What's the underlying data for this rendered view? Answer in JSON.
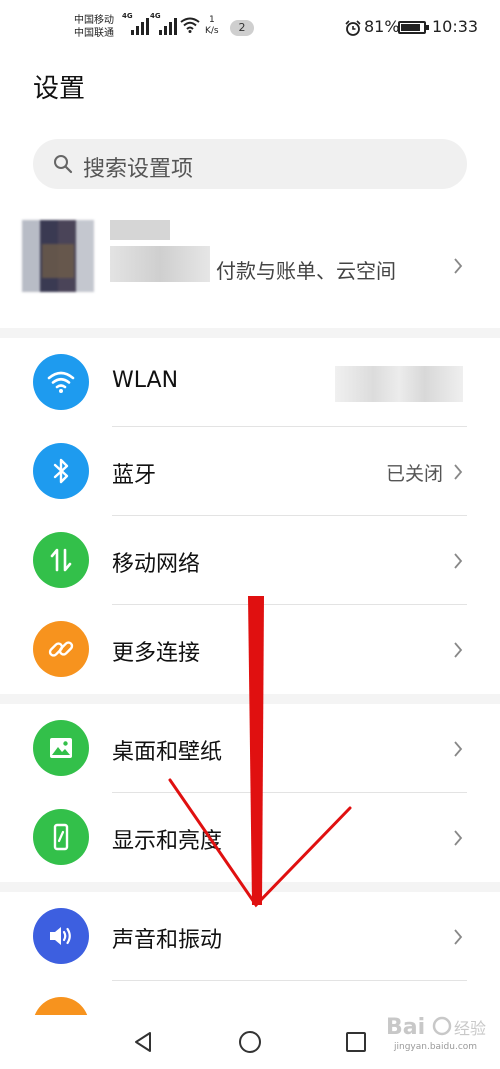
{
  "status_bar": {
    "carrier_1": "中国移动",
    "carrier_2": "中国联通",
    "net_1": "4G",
    "net_2": "4G",
    "speed_value": "1",
    "speed_unit": "K/s",
    "notification_count": "2",
    "battery": "81%",
    "time": "10:33"
  },
  "page": {
    "title": "设置",
    "search_placeholder": "搜索设置项"
  },
  "account": {
    "subtitle": "付款与账单、云空间"
  },
  "settings": [
    {
      "label": "WLAN",
      "value": "",
      "icon": "wifi-icon",
      "color": "#1e9bef"
    },
    {
      "label": "蓝牙",
      "value": "已关闭",
      "icon": "bluetooth-icon",
      "color": "#1e9bef"
    },
    {
      "label": "移动网络",
      "value": "",
      "icon": "mobile-data-icon",
      "color": "#33c04a"
    },
    {
      "label": "更多连接",
      "value": "",
      "icon": "link-icon",
      "color": "#f7931e"
    },
    {
      "label": "桌面和壁纸",
      "value": "",
      "icon": "image-icon",
      "color": "#33c04a"
    },
    {
      "label": "显示和亮度",
      "value": "",
      "icon": "phone-brightness-icon",
      "color": "#33c04a"
    },
    {
      "label": "声音和振动",
      "value": "",
      "icon": "speaker-icon",
      "color": "#3d5fe0"
    }
  ],
  "watermark": {
    "text": "jingyan.baidu.com"
  },
  "colors": {
    "annotation_red": "#e01010",
    "separator": "#f4f4f4"
  }
}
